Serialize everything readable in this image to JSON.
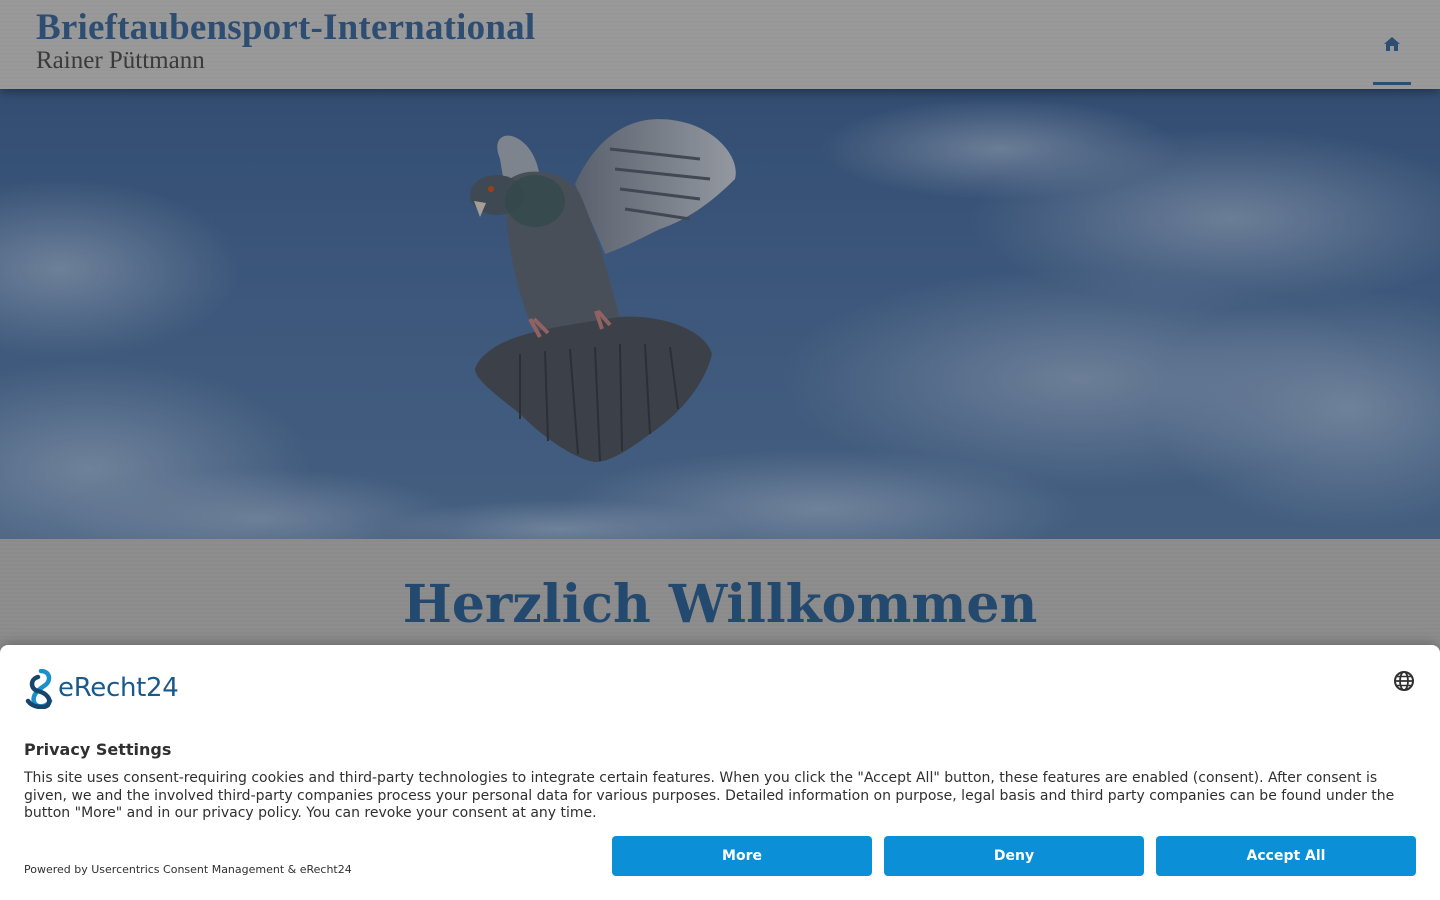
{
  "header": {
    "title": "Brieftaubensport-International",
    "subtitle": "Rainer Püttmann",
    "nav_home_icon": "home-icon"
  },
  "hero": {
    "image": "pigeon-in-flight-over-blue-sky"
  },
  "welcome": {
    "title": "Herzlich Willkommen"
  },
  "consent": {
    "logo_text": "eRecht24",
    "language_icon": "globe-icon",
    "title": "Privacy Settings",
    "text": "This site uses consent-requiring cookies and third-party technologies to integrate certain features. When you click the \"Accept All\" button, these features are enabled (consent). After consent is given, we and the involved third-party companies process your personal data for various purposes. Detailed information on purpose, legal basis and third party companies can be found under the button \"More\" and in our privacy policy. You can revoke your consent at any time.",
    "powered_by": "Powered by Usercentrics Consent Management & eRecht24",
    "buttons": {
      "more": "More",
      "deny": "Deny",
      "accept": "Accept All"
    }
  },
  "colors": {
    "brand_blue": "#2d4e72",
    "button_blue": "#0b8fd6",
    "logo_blue": "#1a5a8a"
  }
}
